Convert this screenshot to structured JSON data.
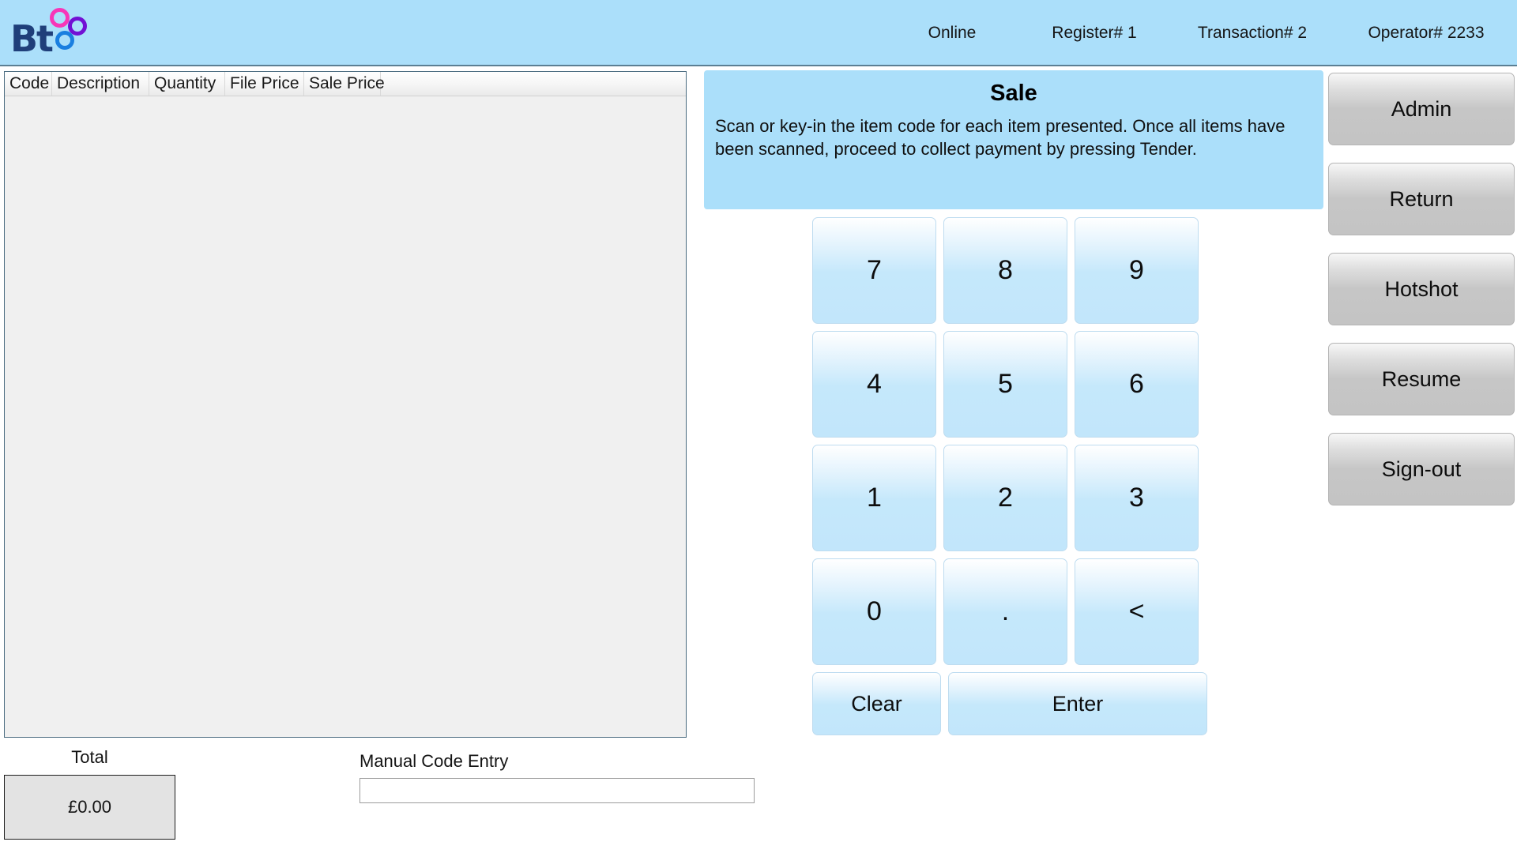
{
  "header": {
    "logo": {
      "text": "Bt",
      "ring_colors": [
        "#f736b8",
        "#7210d4",
        "#1a7fe0"
      ]
    },
    "status": [
      {
        "label": "Online"
      },
      {
        "label": "Register# 1"
      },
      {
        "label": "Transaction# 2"
      },
      {
        "label": "Operator# 2233"
      }
    ],
    "background_color": "#abdffa"
  },
  "item_list": {
    "columns": [
      "Code",
      "Description",
      "Quantity",
      "File Price",
      "Sale Price"
    ],
    "rows": []
  },
  "total": {
    "label": "Total",
    "value": "£0.00"
  },
  "manual_entry": {
    "label": "Manual Code Entry",
    "value": "",
    "placeholder": ""
  },
  "sale_panel": {
    "title": "Sale",
    "instructions": "Scan or key-in the item code for each item presented. Once all items have been scanned, proceed to collect payment by pressing Tender.",
    "background_color": "#abdffa"
  },
  "keypad": {
    "rows": [
      [
        "7",
        "8",
        "9"
      ],
      [
        "4",
        "5",
        "6"
      ],
      [
        "1",
        "2",
        "3"
      ],
      [
        "0",
        ".",
        "<"
      ]
    ],
    "clear_label": "Clear",
    "enter_label": "Enter"
  },
  "actions": [
    {
      "label": "Admin"
    },
    {
      "label": "Return"
    },
    {
      "label": "Hotshot"
    },
    {
      "label": "Resume"
    },
    {
      "label": "Sign-out"
    }
  ]
}
